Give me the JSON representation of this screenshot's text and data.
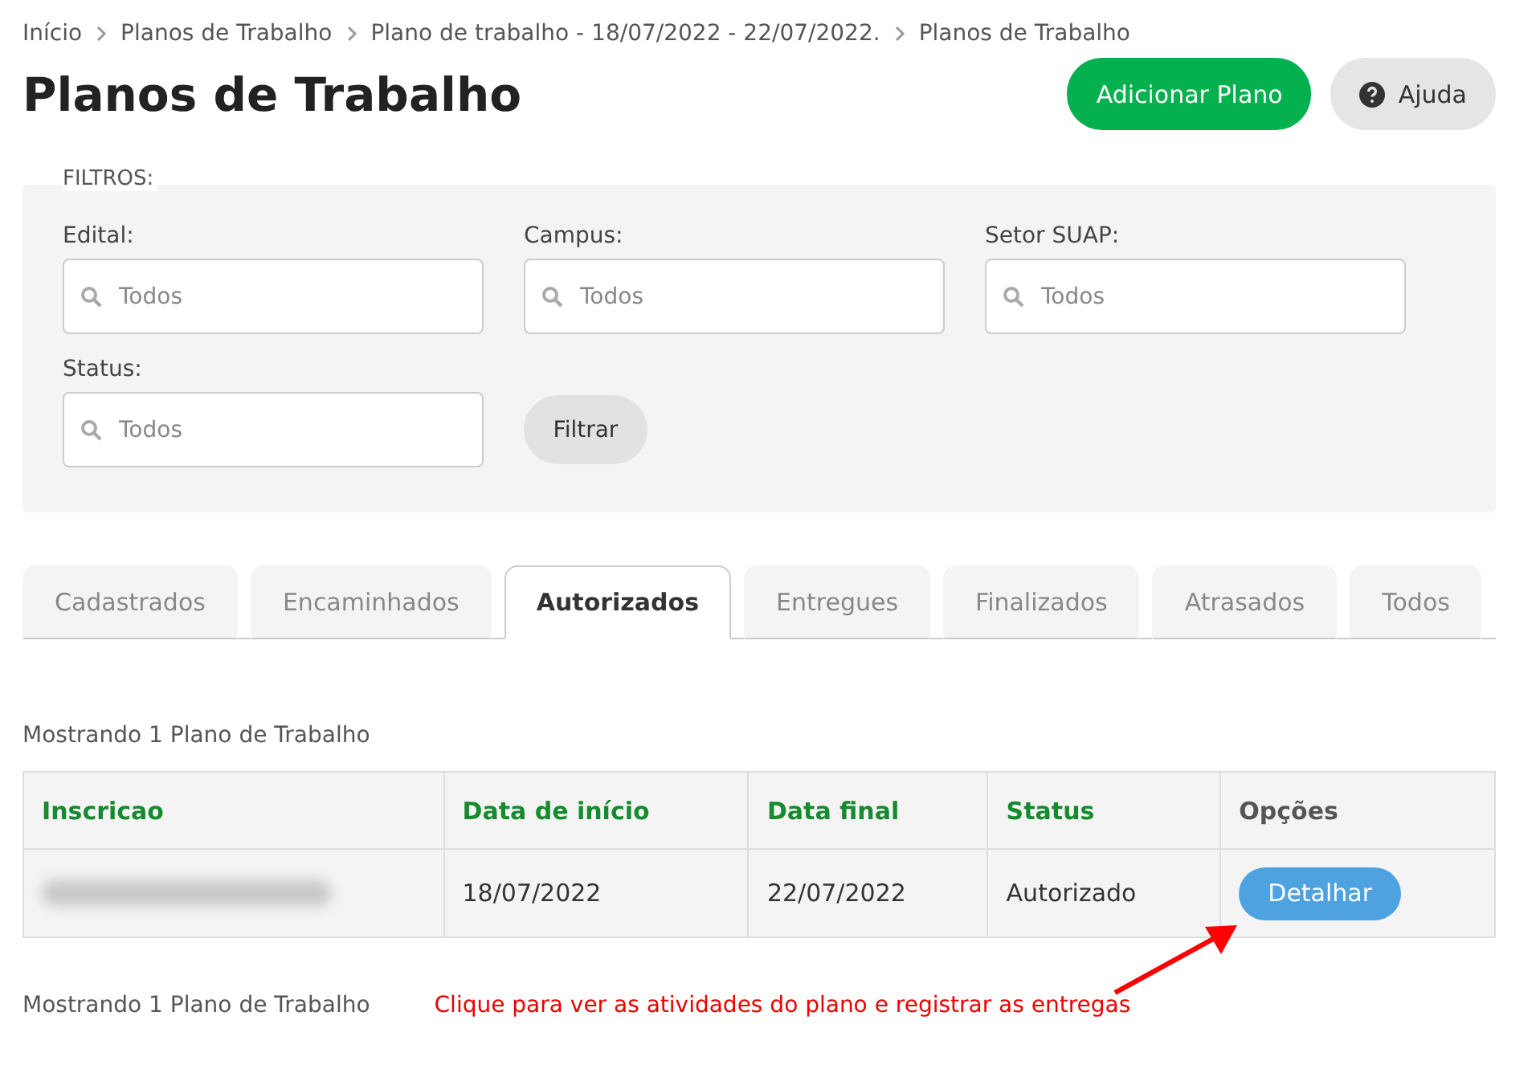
{
  "breadcrumb": [
    "Início",
    "Planos de Trabalho",
    "Plano de trabalho - 18/07/2022 - 22/07/2022.",
    "Planos de Trabalho"
  ],
  "title": "Planos de Trabalho",
  "actions": [
    {
      "kind": "primary",
      "label": "Adicionar Plano"
    },
    {
      "kind": "help",
      "label": "Ajuda"
    }
  ],
  "filters": {
    "legend": "FILTROS:",
    "fields": [
      {
        "label": "Edital:",
        "placeholder": "Todos"
      },
      {
        "label": "Campus:",
        "placeholder": "Todos"
      },
      {
        "label": "Setor SUAP:",
        "placeholder": "Todos"
      },
      {
        "label": "Status:",
        "placeholder": "Todos"
      }
    ],
    "button": "Filtrar"
  },
  "tabs": [
    {
      "label": "Cadastrados",
      "selected": false
    },
    {
      "label": "Encaminhados",
      "selected": false
    },
    {
      "label": "Autorizados",
      "selected": true
    },
    {
      "label": "Entregues",
      "selected": false
    },
    {
      "label": "Finalizados",
      "selected": false
    },
    {
      "label": "Atrasados",
      "selected": false
    },
    {
      "label": "Todos",
      "selected": false
    }
  ],
  "count_top": "Mostrando 1 Plano de Trabalho",
  "table": {
    "columns": [
      "Inscricao",
      "Data de início",
      "Data final",
      "Status",
      "Opções"
    ],
    "rows": [
      {
        "inscricao_redacted": true,
        "start": "18/07/2022",
        "end": "22/07/2022",
        "status": "Autorizado",
        "action": "Detalhar"
      }
    ]
  },
  "count_bottom": "Mostrando 1 Plano de Trabalho",
  "annotation": "Clique para ver as atividades do plano e registrar as entregas"
}
